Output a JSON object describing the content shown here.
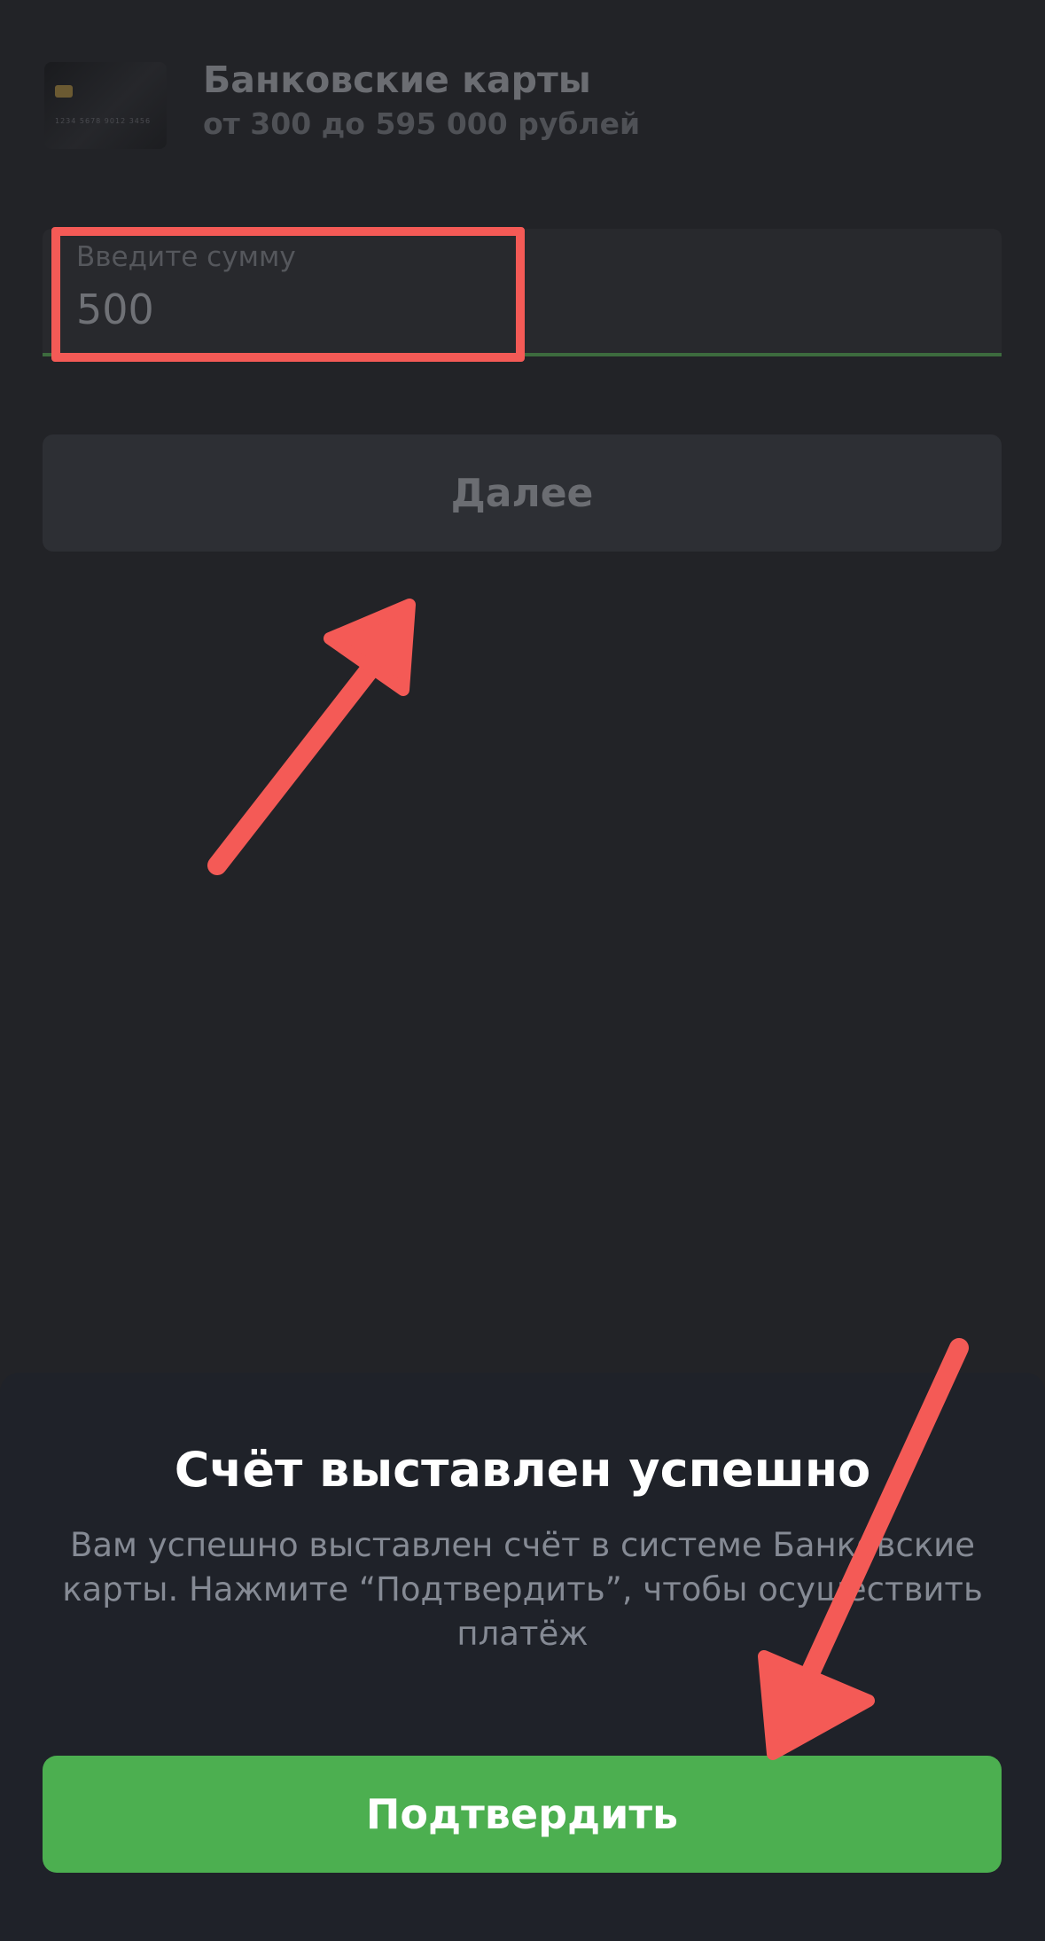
{
  "payment_method": {
    "title": "Банковские карты",
    "range": "от 300 до 595 000 рублей",
    "card_number_digits": "1234  5678  9012  3456"
  },
  "amount_input": {
    "label": "Введите сумму",
    "value": "500"
  },
  "next_button": {
    "label": "Далее"
  },
  "success_sheet": {
    "title": "Счёт выставлен успешно",
    "message": "Вам успешно выставлен счёт в системе Банковские карты. Нажмите “Подтвердить”, чтобы осуществить платёж",
    "confirm_label": "Подтвердить"
  },
  "colors": {
    "accent_green": "#4caf50",
    "annotation_red": "#f45a56",
    "background": "#222327",
    "sheet_background": "#1f2229"
  }
}
